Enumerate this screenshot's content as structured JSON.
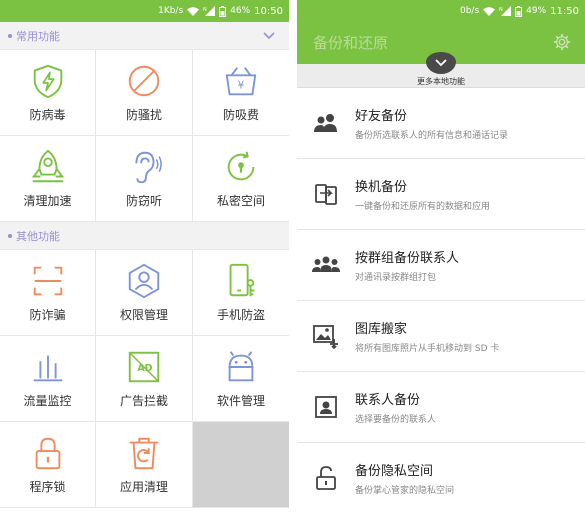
{
  "left": {
    "status": {
      "speed": "1Kb/s",
      "battery": "46%",
      "time": "10:50"
    },
    "sections": [
      {
        "title": "常用功能",
        "items": [
          {
            "label": "防病毒",
            "icon": "shield-icon"
          },
          {
            "label": "防骚扰",
            "icon": "no-sign-icon"
          },
          {
            "label": "防吸费",
            "icon": "yuan-basket-icon"
          },
          {
            "label": "清理加速",
            "icon": "rocket-icon"
          },
          {
            "label": "防窃听",
            "icon": "ear-icon"
          },
          {
            "label": "私密空间",
            "icon": "lock-circle-icon"
          }
        ]
      },
      {
        "title": "其他功能",
        "items": [
          {
            "label": "防诈骗",
            "icon": "scan-frame-icon"
          },
          {
            "label": "权限管理",
            "icon": "user-hexagon-icon"
          },
          {
            "label": "手机防盗",
            "icon": "phone-key-icon"
          },
          {
            "label": "流量监控",
            "icon": "bars-icon"
          },
          {
            "label": "广告拦截",
            "icon": "ad-block-icon"
          },
          {
            "label": "软件管理",
            "icon": "android-icon"
          },
          {
            "label": "程序锁",
            "icon": "padlock-icon"
          },
          {
            "label": "应用清理",
            "icon": "trash-icon"
          }
        ]
      }
    ]
  },
  "right": {
    "status": {
      "speed": "0b/s",
      "battery": "49%",
      "time": "11:50"
    },
    "title": "备份和还原",
    "more_label": "更多本地功能",
    "items": [
      {
        "title": "好友备份",
        "subtitle": "备份所选联系人的所有信息和通话记录",
        "icon": "contacts-icon"
      },
      {
        "title": "换机备份",
        "subtitle": "一键备份和还原所有的数据和应用",
        "icon": "phone-switch-icon"
      },
      {
        "title": "按群组备份联系人",
        "subtitle": "对通讯录按群组打包",
        "icon": "group-icon"
      },
      {
        "title": "图库搬家",
        "subtitle": "将所有图库照片从手机移动到 SD 卡",
        "icon": "gallery-move-icon"
      },
      {
        "title": "联系人备份",
        "subtitle": "选择要备份的联系人",
        "icon": "contact-card-icon"
      },
      {
        "title": "备份隐私空间",
        "subtitle": "备份掌心管家的隐私空间",
        "icon": "unlock-icon"
      }
    ]
  },
  "colors": {
    "green": "#7cc242",
    "purple": "#9a8fd2",
    "orange": "#f08a5d",
    "blue": "#7f95d9"
  }
}
